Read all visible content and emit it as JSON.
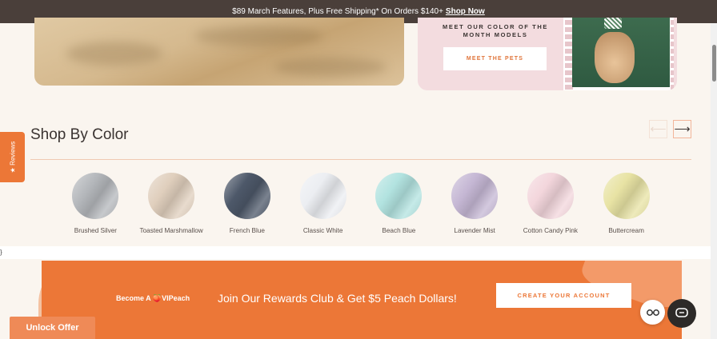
{
  "announcement": {
    "text": "$89 March Features, Plus Free Shipping* On Orders $140+",
    "link": "Shop Now"
  },
  "promo": {
    "heading": "MEET OUR COLOR OF THE MONTH MODELS",
    "button": "MEET THE PETS"
  },
  "shop_by_color": {
    "title": "Shop By Color",
    "prev_icon": "arrow-left-icon",
    "next_icon": "arrow-right-icon",
    "swatches": [
      {
        "label": "Brushed Silver",
        "color": "#b4b7bb"
      },
      {
        "label": "Toasted Marshmallow",
        "color": "#e0cfbd"
      },
      {
        "label": "French Blue",
        "color": "#4d5869"
      },
      {
        "label": "Classic White",
        "color": "#eceef2"
      },
      {
        "label": "Beach Blue",
        "color": "#b2e3e0"
      },
      {
        "label": "Lavender Mist",
        "color": "#c5b7d4"
      },
      {
        "label": "Cotton Candy Pink",
        "color": "#f3d6dc"
      },
      {
        "label": "Buttercream",
        "color": "#e8e3a4"
      }
    ]
  },
  "reviews_tab": {
    "label": "★ Reviews"
  },
  "stray_char": "}",
  "rewards": {
    "brand_prefix": "Become A",
    "brand_name": "VIPeach",
    "text": "Join Our Rewards Club & Get $5 Peach Dollars!",
    "button": "CREATE YOUR ACCOUNT"
  },
  "unlock_offer": "Unlock Offer",
  "colors": {
    "accent": "#ec7737",
    "announcement_bg": "#4a3f3a",
    "page_bg": "#faf5ef"
  }
}
